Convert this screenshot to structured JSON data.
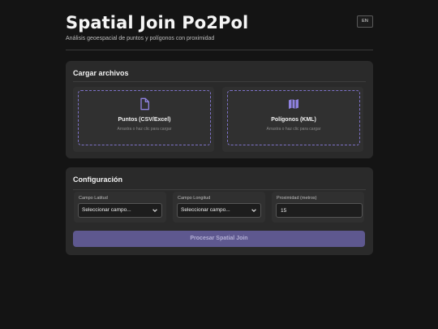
{
  "header": {
    "title": "Spatial Join Po2Pol",
    "subtitle": "Análisis geoespacial de puntos y polígonos con proximidad",
    "lang_button": "EN"
  },
  "upload": {
    "title": "Cargar archivos",
    "points": {
      "label": "Puntos (CSV/Excel)",
      "hint": "Arrastra o haz clic para cargar",
      "icon": "file-icon"
    },
    "polygons": {
      "label": "Polígonos (KML)",
      "hint": "Arrastra o haz clic para cargar",
      "icon": "map-icon"
    }
  },
  "config": {
    "title": "Configuración",
    "lat": {
      "label": "Campo Latitud",
      "value": "Seleccionar campo..."
    },
    "lon": {
      "label": "Campo Longitud",
      "value": "Seleccionar campo..."
    },
    "prox": {
      "label": "Proximidad (metros)",
      "value": "15"
    },
    "submit_label": "Procesar Spatial Join"
  },
  "colors": {
    "accent": "#7e72c8",
    "button_bg": "#5e588f",
    "background": "#141414",
    "card": "#2a2a2a"
  }
}
